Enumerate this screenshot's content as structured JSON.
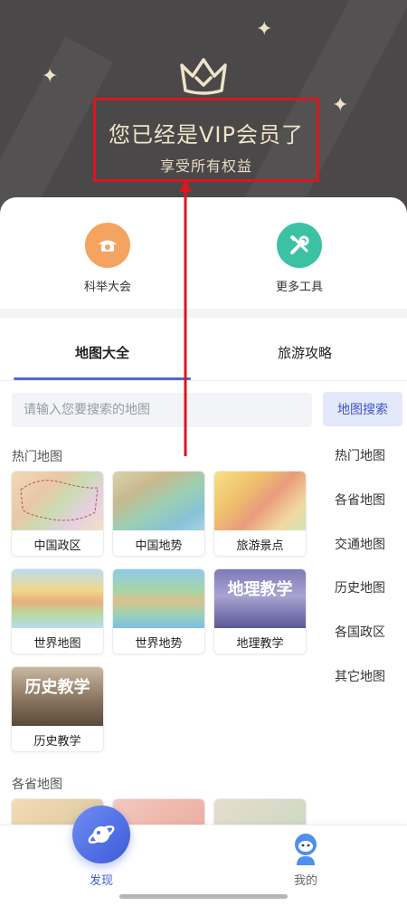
{
  "header": {
    "vip_title": "您已经是VIP会员了",
    "vip_subtitle": "享受所有权益",
    "crown_icon": "crown-icon",
    "highlight_color": "#d9171c"
  },
  "tools": [
    {
      "label": "科举大会",
      "icon": "cap-badge-icon",
      "color": "#f4a460"
    },
    {
      "label": "更多工具",
      "icon": "tools-icon",
      "color": "#3cc2a3"
    }
  ],
  "tabs": [
    {
      "label": "地图大全",
      "active": true
    },
    {
      "label": "旅游攻略",
      "active": false
    }
  ],
  "search": {
    "placeholder": "请输入您要搜索的地图",
    "button_label": "地图搜索"
  },
  "sections": {
    "hot_title": "热门地图",
    "province_title": "各省地图"
  },
  "hot_maps": [
    {
      "label": "中国政区"
    },
    {
      "label": "中国地势"
    },
    {
      "label": "旅游景点"
    },
    {
      "label": "世界地图"
    },
    {
      "label": "世界地势"
    },
    {
      "label": "地理教学",
      "overlay": "地理教学"
    },
    {
      "label": "历史教学",
      "overlay": "历史教学"
    }
  ],
  "side_categories": [
    "热门地图",
    "各省地图",
    "交通地图",
    "历史地图",
    "各国政区",
    "其它地图"
  ],
  "bottom_nav": {
    "discover_label": "发现",
    "mine_label": "我的",
    "accent": "#3d5bd8"
  }
}
